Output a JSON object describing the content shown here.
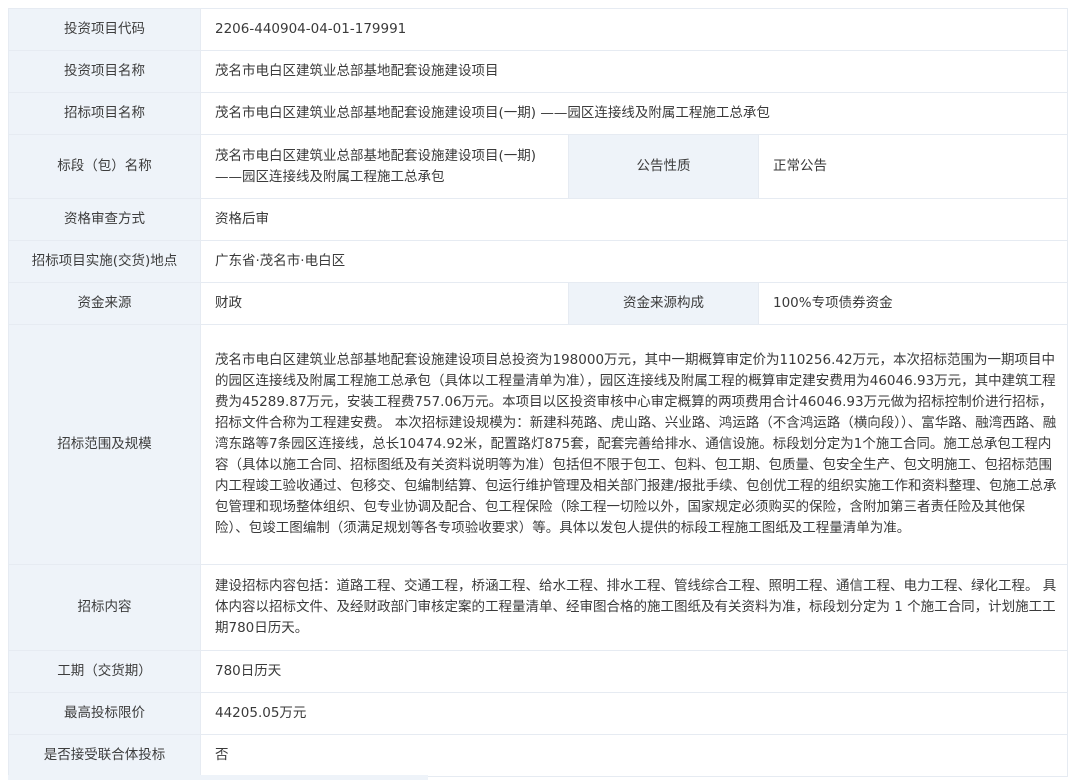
{
  "rows": {
    "project_code": {
      "label": "投资项目代码",
      "value": "2206-440904-04-01-179991"
    },
    "project_name": {
      "label": "投资项目名称",
      "value": "茂名市电白区建筑业总部基地配套设施建设项目"
    },
    "tender_name": {
      "label": "招标项目名称",
      "value": "茂名市电白区建筑业总部基地配套设施建设项目(一期) ——园区连接线及附属工程施工总承包"
    },
    "section_name": {
      "label": "标段（包）名称",
      "value_line1": "茂名市电白区建筑业总部基地配套设施建设项目(一期)",
      "value_line2": "——园区连接线及附属工程施工总承包"
    },
    "notice_type": {
      "label": "公告性质",
      "value": "正常公告"
    },
    "qualification": {
      "label": "资格审查方式",
      "value": "资格后审"
    },
    "location": {
      "label": "招标项目实施(交货)地点",
      "value": "广东省·茂名市·电白区"
    },
    "fund_source": {
      "label": "资金来源",
      "value": "财政"
    },
    "fund_structure": {
      "label": "资金来源构成",
      "value": "100%专项债券资金"
    },
    "scope": {
      "label": "招标范围及规模",
      "value": "茂名市电白区建筑业总部基地配套设施建设项目总投资为198000万元，其中一期概算审定价为110256.42万元，本次招标范围为一期项目中的园区连接线及附属工程施工总承包（具体以工程量清单为准），园区连接线及附属工程的概算审定建安费用为46046.93万元，其中建筑工程费为45289.87万元，安装工程费757.06万元。本项目以区投资审核中心审定概算的两项费用合计46046.93万元做为招标控制价进行招标，招标文件合称为工程建安费。 本次招标建设规模为：新建科苑路、虎山路、兴业路、鸿运路（不含鸿运路（横向段））、富华路、融湾西路、融湾东路等7条园区连接线，总长10474.92米，配置路灯875套，配套完善给排水、通信设施。标段划分定为1个施工合同。施工总承包工程内容（具体以施工合同、招标图纸及有关资料说明等为准）包括但不限于包工、包料、包工期、包质量、包安全生产、包文明施工、包招标范围内工程竣工验收通过、包移交、包编制结算、包运行维护管理及相关部门报建/报批手续、包创优工程的组织实施工作和资料整理、包施工总承包管理和现场整体组织、包专业协调及配合、包工程保险（除工程一切险以外，国家规定必须购买的保险，含附加第三者责任险及其他保险）、包竣工图编制（须满足规划等各专项验收要求）等。具体以发包人提供的标段工程施工图纸及工程量清单为准。"
    },
    "content": {
      "label": "招标内容",
      "value": "建设招标内容包括：道路工程、交通工程，桥涵工程、给水工程、排水工程、管线综合工程、照明工程、通信工程、电力工程、绿化工程。 具体内容以招标文件、及经财政部门审核定案的工程量清单、经审图合格的施工图纸及有关资料为准，标段划分定为 1 个施工合同，计划施工工期780日历天。"
    },
    "duration": {
      "label": "工期（交货期）",
      "value": "780日历天"
    },
    "max_price": {
      "label": "最高投标限价",
      "value": "44205.05万元"
    },
    "consortium": {
      "label": "是否接受联合体投标",
      "value": "否"
    }
  },
  "colors": {
    "label_bg": "#eef3f9",
    "border": "#e6ebf2",
    "text": "#3a3a3a"
  }
}
